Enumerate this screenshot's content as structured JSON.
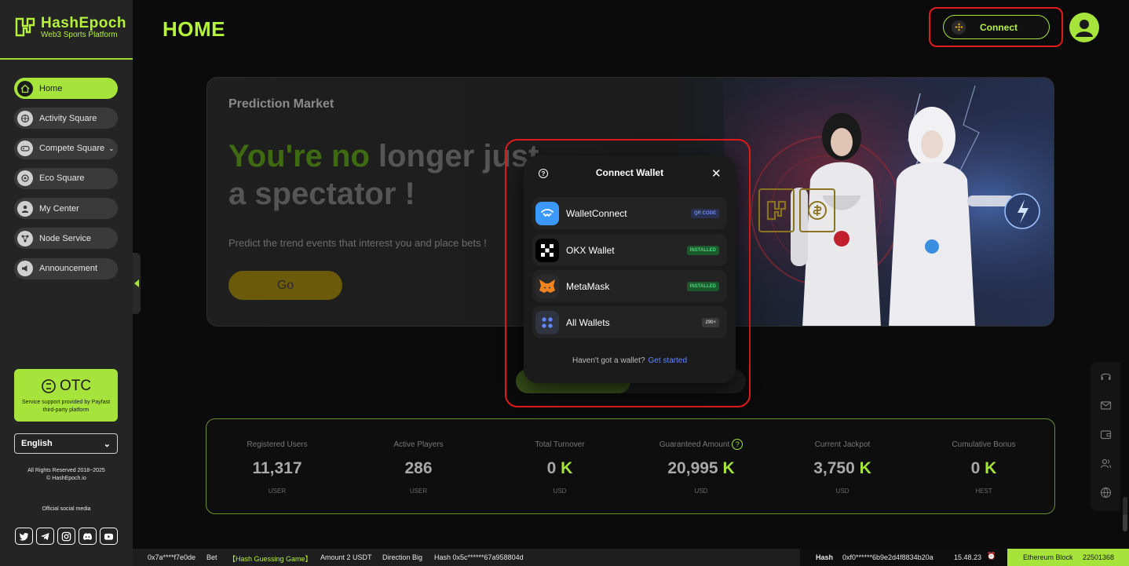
{
  "brand": {
    "name": "HashEpoch",
    "tagline": "Web3 Sports Platform"
  },
  "header": {
    "title": "HOME",
    "connect_label": "Connect"
  },
  "sidebar": {
    "items": [
      {
        "label": "Home",
        "icon": "home-icon",
        "active": true
      },
      {
        "label": "Activity Square",
        "icon": "activity-icon"
      },
      {
        "label": "Compete Square",
        "icon": "gamepad-icon",
        "has_dropdown": true
      },
      {
        "label": "Eco Square",
        "icon": "eco-icon"
      },
      {
        "label": "My Center",
        "icon": "user-icon"
      },
      {
        "label": "Node Service",
        "icon": "node-icon"
      },
      {
        "label": "Announcement",
        "icon": "announcement-icon"
      }
    ],
    "otc": {
      "title": "OTC",
      "subtitle": "Service support provided by Payfast third-party platform"
    },
    "language": "English",
    "rights_line1": "All Rights Reserved 2018~2025",
    "rights_line2": "© HashEpoch.io",
    "social_label": "Official social media",
    "socials": [
      "twitter-icon",
      "telegram-icon",
      "instagram-icon",
      "discord-icon",
      "youtube-icon"
    ]
  },
  "banner": {
    "label": "Prediction Market",
    "headline_green": "You're no",
    "headline_rest": " longer just",
    "headline_line2": "a spectator !",
    "description": "Predict the trend events that interest you and place bets !",
    "go_label": "Go"
  },
  "stats": [
    {
      "label": "Registered Users",
      "value": "11,317",
      "suffix": "",
      "unit": "USER"
    },
    {
      "label": "Active Players",
      "value": "286",
      "suffix": "",
      "unit": "USER"
    },
    {
      "label": "Total Turnover",
      "value": "0 ",
      "suffix": "K",
      "unit": "USD"
    },
    {
      "label": "Guaranteed Amount",
      "value": "20,995 ",
      "suffix": "K",
      "unit": "USD",
      "help": "?"
    },
    {
      "label": "Current Jackpot",
      "value": "3,750 ",
      "suffix": "K",
      "unit": "USD"
    },
    {
      "label": "Cumulative Bonus",
      "value": "0 ",
      "suffix": "K",
      "unit": "HEST"
    }
  ],
  "modal": {
    "title": "Connect Wallet",
    "help": "?",
    "close": "✕",
    "wallets": [
      {
        "name": "WalletConnect",
        "badge": "QR CODE",
        "icon": "walletconnect-icon"
      },
      {
        "name": "OKX Wallet",
        "badge": "INSTALLED",
        "icon": "okx-icon"
      },
      {
        "name": "MetaMask",
        "badge": "INSTALLED",
        "icon": "metamask-icon"
      },
      {
        "name": "All Wallets",
        "badge": "290+",
        "icon": "grid-icon"
      }
    ],
    "footer_text": "Haven't got a wallet?",
    "footer_link": "Get started"
  },
  "ticker": {
    "addr": "0x7a****f7e0de",
    "action": "Bet",
    "game": "【Hash Guessing Game】",
    "amount": "Amount 2 USDT",
    "direction": "Direction Big",
    "hash_item": "Hash 0x5c******67a958804d",
    "hash_label": "Hash",
    "hash_value": "0xf0******6b9e2d4f8834b20a",
    "time": "15.48.23",
    "block_label": "Ethereum Block",
    "block_value": "22501368"
  },
  "colors": {
    "accent": "#a6e43b",
    "highlight": "#e01b1b"
  }
}
